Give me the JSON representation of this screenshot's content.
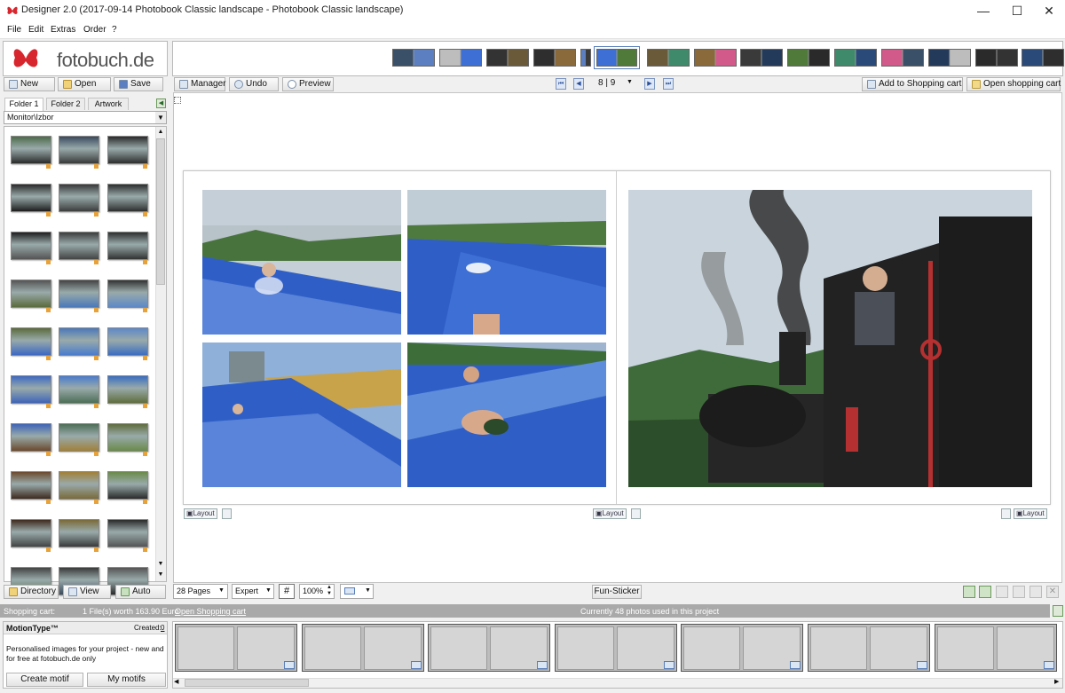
{
  "window": {
    "title": "Designer 2.0 (2017-09-14 Photobook Classic landscape - Photobook Classic landscape)",
    "minimize": "—",
    "maximize": "☐",
    "close": "✕"
  },
  "menu": [
    "File",
    "Edit",
    "Extras",
    "Order",
    "?"
  ],
  "brand": {
    "logo_text": "fotobuch.de",
    "accent": "#d7262d"
  },
  "file_buttons": {
    "new": "New",
    "open": "Open",
    "save": "Save"
  },
  "tabs": [
    "Folder 1",
    "Folder 2",
    "Artwork"
  ],
  "folder_path": "Monitor\\Izbor",
  "sidebar_bottom": {
    "directory": "Directory",
    "view": "View",
    "auto": "Auto"
  },
  "toolbar": {
    "manager": "Manager",
    "undo": "Undo",
    "preview": "Preview",
    "page_indicator": "8 | 9",
    "add_to_cart": "Add to Shopping cart",
    "open_cart": "Open shopping cart"
  },
  "bottom_toolbar": {
    "pages": "28 Pages",
    "mode": "Expert",
    "zoom": "100%",
    "fun_sticker": "Fun-Sticker"
  },
  "layout_label": "Layout",
  "status": {
    "cart_label": "Shopping cart:",
    "cart_info": "1 File(s) worth 163.90 Euro",
    "cart_link": "Open Shopping cart",
    "photos_used": "Currently 48 photos used in this project"
  },
  "motion": {
    "title": "MotionType™",
    "created_label": "Created:",
    "created_value": "0",
    "description": "Personalised images for your project - new and for free at fotobuch.de only",
    "create": "Create motif",
    "my": "My motifs"
  },
  "colors": {
    "slide_blue": "#2f5fc6",
    "sky": "#c9d4dd",
    "forest": "#3f6b3a",
    "train_dark": "#222"
  }
}
